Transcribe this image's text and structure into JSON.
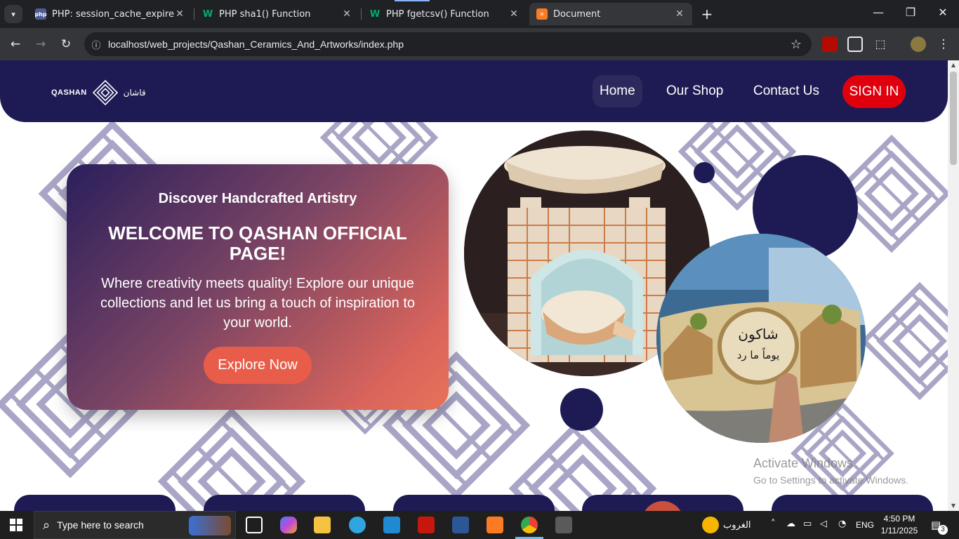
{
  "browser": {
    "tabs": [
      {
        "title": "PHP: session_cache_expire - Ma",
        "favicon": "php-icon"
      },
      {
        "title": "PHP sha1() Function",
        "favicon": "w3schools-icon"
      },
      {
        "title": "PHP fgetcsv() Function",
        "favicon": "w3schools-icon"
      },
      {
        "title": "Document",
        "favicon": "xampp-icon",
        "active": true
      }
    ],
    "url": "localhost/web_projects/Qashan_Ceramics_And_Artworks/index.php"
  },
  "site": {
    "logo_en": "QASHAN",
    "logo_ar": "قاشان",
    "nav": {
      "home": "Home",
      "shop": "Our Shop",
      "contact": "Contact Us",
      "signin": "SIGN IN"
    },
    "hero": {
      "eyebrow": "Discover Handcrafted Artistry",
      "title": "WELCOME TO QASHAN OFFICIAL PAGE!",
      "text": "Where creativity meets quality! Explore our unique collections and let us bring a touch of inspiration to your world.",
      "button": "Explore Now"
    },
    "plaque_text_line1": "شاكون",
    "plaque_text_line2": "يوماً ما رد",
    "colors": {
      "navy": "#1e1b54",
      "signin_red": "#e0000d",
      "button_coral": "#e85d4a"
    }
  },
  "watermark": {
    "line1": "Activate Windows",
    "line2": "Go to Settings to activate Windows."
  },
  "taskbar": {
    "search_placeholder": "Type here to search",
    "weather": "الغروب",
    "language": "ENG",
    "time": "4:50 PM",
    "date": "1/11/2025",
    "notifications": "3"
  }
}
